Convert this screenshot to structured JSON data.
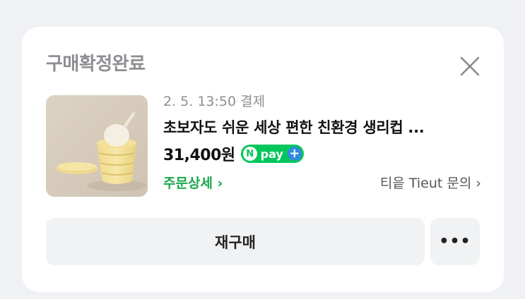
{
  "order": {
    "status": "구매확정완료",
    "payment_date": "2. 5. 13:50 결제",
    "product_title": "초보자도 쉬운 세상 편한 친환경 생리컵 ...",
    "price": "31,400원",
    "npay_label": "pay",
    "npay_n": "N",
    "npay_plus": "+",
    "detail_link": "주문상세 ›",
    "seller_link": "티읕 Tieut 문의 ›"
  },
  "actions": {
    "rebuy_label": "재구매",
    "more_label": "•••"
  },
  "icons": {
    "close": "close-icon",
    "npay": "npay-plus-badge"
  },
  "colors": {
    "background": "#f0f1f4",
    "card": "#ffffff",
    "status_gray": "#8e8e93",
    "npay_green": "#03c75a",
    "npay_plus_blue": "#2f8ae0",
    "link_green": "#17a84a"
  }
}
